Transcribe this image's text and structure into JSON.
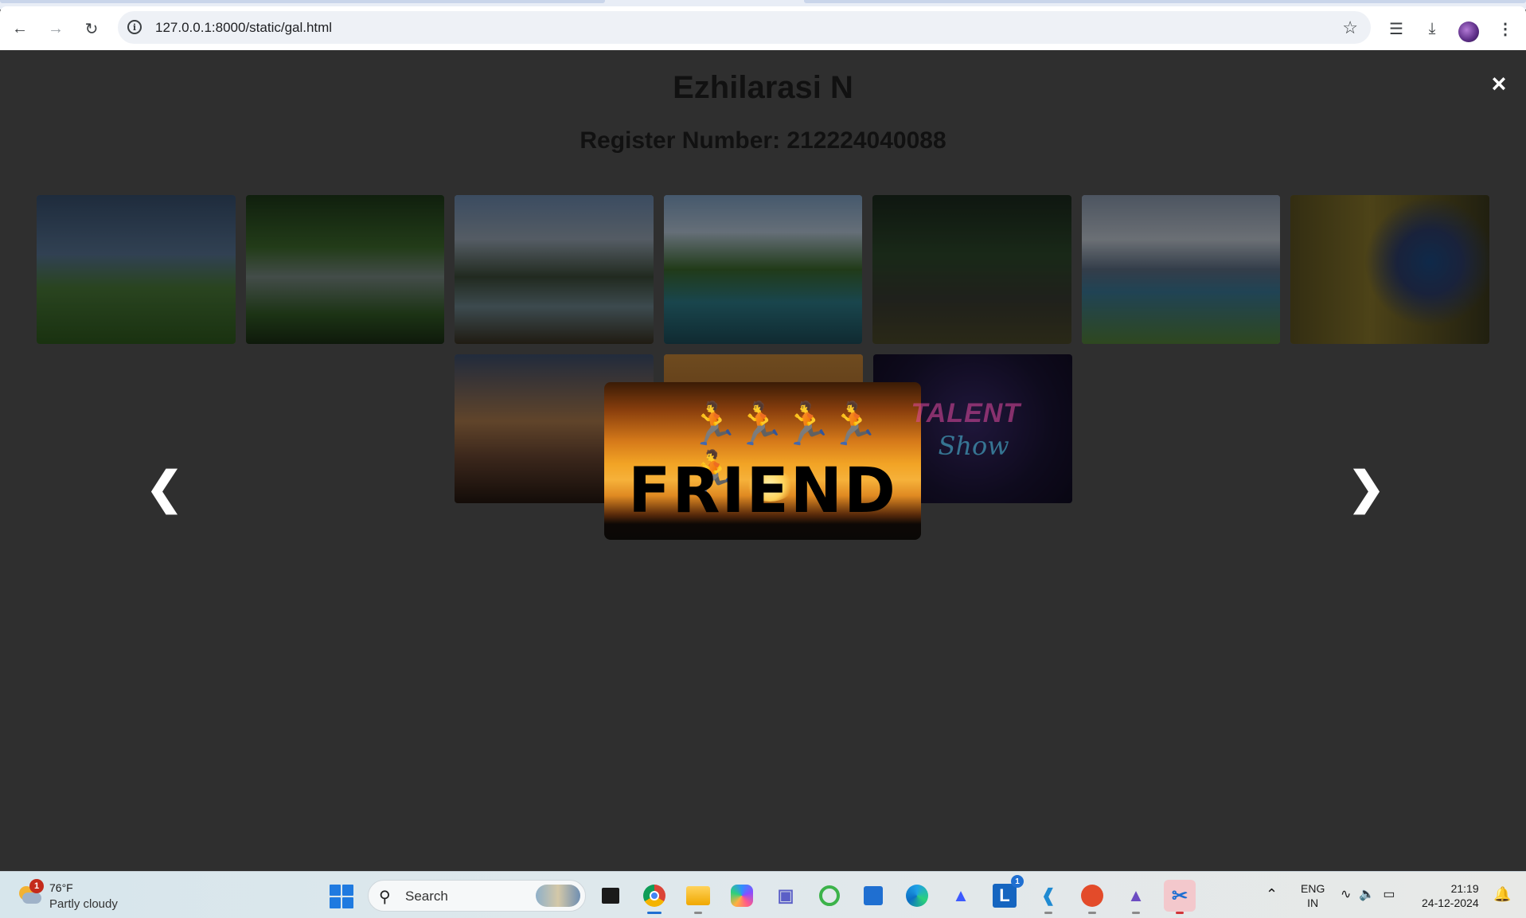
{
  "browser": {
    "url": "127.0.0.1:8000/static/gal.html",
    "icons": [
      "back-icon",
      "forward-icon",
      "reload-icon",
      "site-info-icon",
      "bookmark-star-icon",
      "media-controls-icon",
      "downloads-icon",
      "profile-avatar",
      "more-menu-icon"
    ]
  },
  "page": {
    "title": "Ezhilarasi N",
    "subtitle": "Register Number: 212224040088",
    "close_symbol": "×",
    "prev_symbol": "❮",
    "next_symbol": "❯"
  },
  "gallery": {
    "row1": [
      {
        "name": "gallery-thumb-sky-meadow"
      },
      {
        "name": "gallery-thumb-forest-stream"
      },
      {
        "name": "gallery-thumb-mountain-river"
      },
      {
        "name": "gallery-thumb-waterfall-lake"
      },
      {
        "name": "gallery-thumb-forest-road"
      },
      {
        "name": "gallery-thumb-alpine-lake"
      },
      {
        "name": "gallery-thumb-peacock"
      }
    ],
    "row2": [
      {
        "name": "gallery-thumb-climbers"
      },
      {
        "name": "gallery-thumb-sunset-jump"
      },
      {
        "name": "gallery-thumb-talent-show",
        "text_1": "TALENT",
        "text_2": "Show"
      }
    ]
  },
  "lightbox": {
    "image_text": "FRIEND"
  },
  "taskbar": {
    "weather": {
      "badge": "1",
      "temperature": "76°F",
      "condition": "Partly cloudy"
    },
    "search_placeholder": "Search",
    "apps": [
      "task-view",
      "chrome",
      "file-explorer",
      "copilot",
      "teams",
      "app-green-circle",
      "microsoft-store",
      "edge",
      "app-launcher",
      "app-L",
      "vscode",
      "wps-office",
      "photos",
      "snipping-tool"
    ],
    "app_L_label": "L",
    "app_L_badge": "1",
    "language_1": "ENG",
    "language_2": "IN",
    "time": "21:19",
    "date": "24-12-2024"
  }
}
